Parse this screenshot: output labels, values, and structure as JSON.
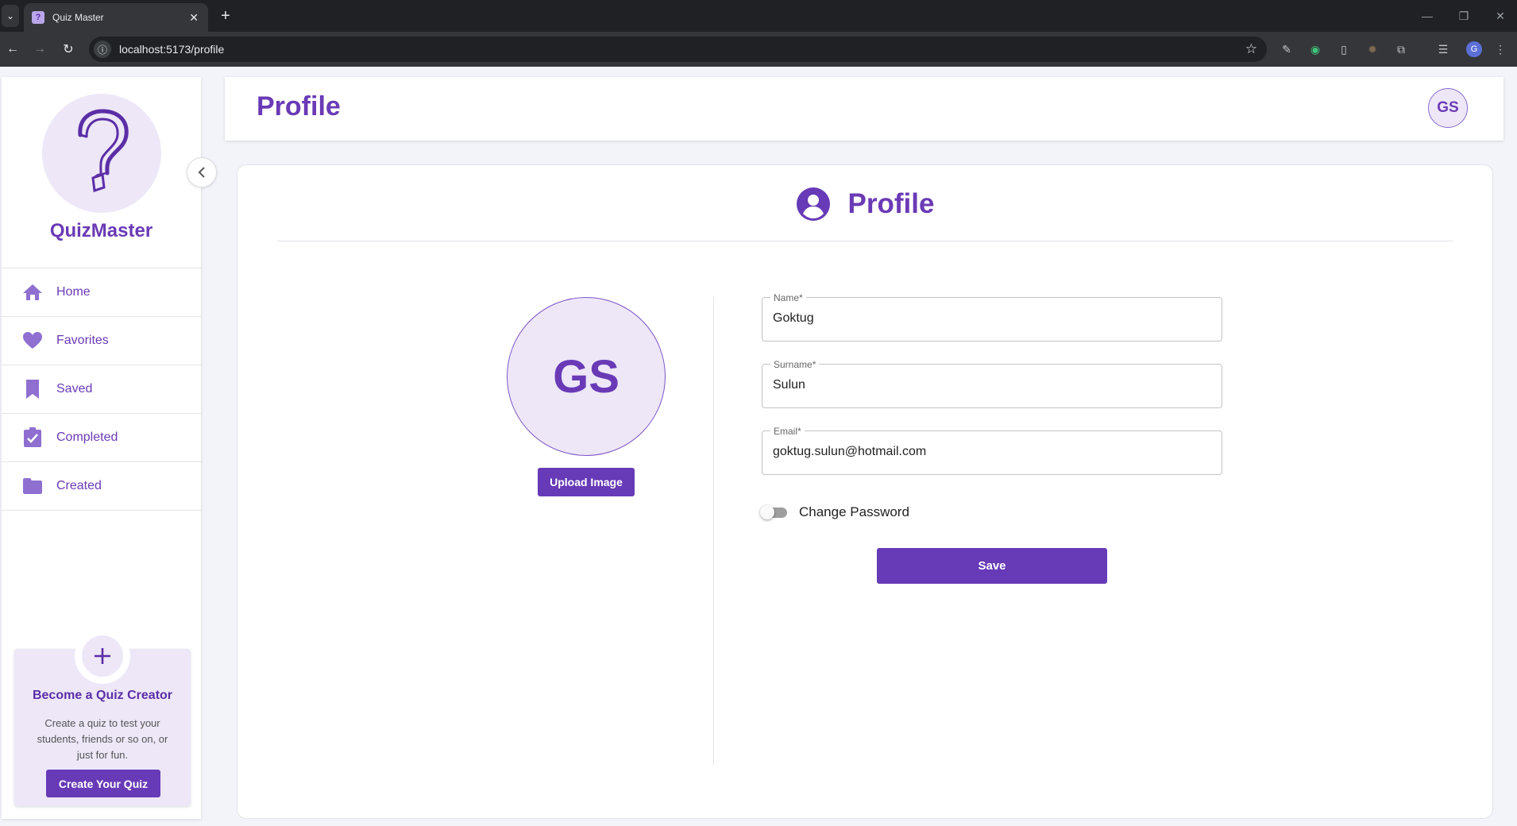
{
  "browser": {
    "tab_title": "Quiz Master",
    "url": "localhost:5173/profile",
    "profile_initial": "G"
  },
  "sidebar": {
    "brand": "QuizMaster",
    "items": [
      {
        "label": "Home",
        "icon": "home-icon"
      },
      {
        "label": "Favorites",
        "icon": "heart-icon"
      },
      {
        "label": "Saved",
        "icon": "bookmark-icon"
      },
      {
        "label": "Completed",
        "icon": "clipboard-check-icon"
      },
      {
        "label": "Created",
        "icon": "folder-icon"
      }
    ],
    "creator": {
      "title": "Become a Quiz Creator",
      "text": "Create a quiz to test your students, friends or so on, or just for fun.",
      "button": "Create Your Quiz"
    }
  },
  "header": {
    "title": "Profile",
    "avatar_initials": "GS"
  },
  "profile": {
    "heading": "Profile",
    "avatar_initials": "GS",
    "upload_button": "Upload Image",
    "fields": {
      "name": {
        "label": "Name*",
        "value": "Goktug"
      },
      "surname": {
        "label": "Surname*",
        "value": "Sulun"
      },
      "email": {
        "label": "Email*",
        "value": "goktug.sulun@hotmail.com"
      }
    },
    "change_password_label": "Change Password",
    "change_password_enabled": false,
    "save_button": "Save"
  },
  "colors": {
    "accent": "#673ab7",
    "accent_light": "#ede7f8",
    "nav_icon": "#8f6fd0"
  }
}
